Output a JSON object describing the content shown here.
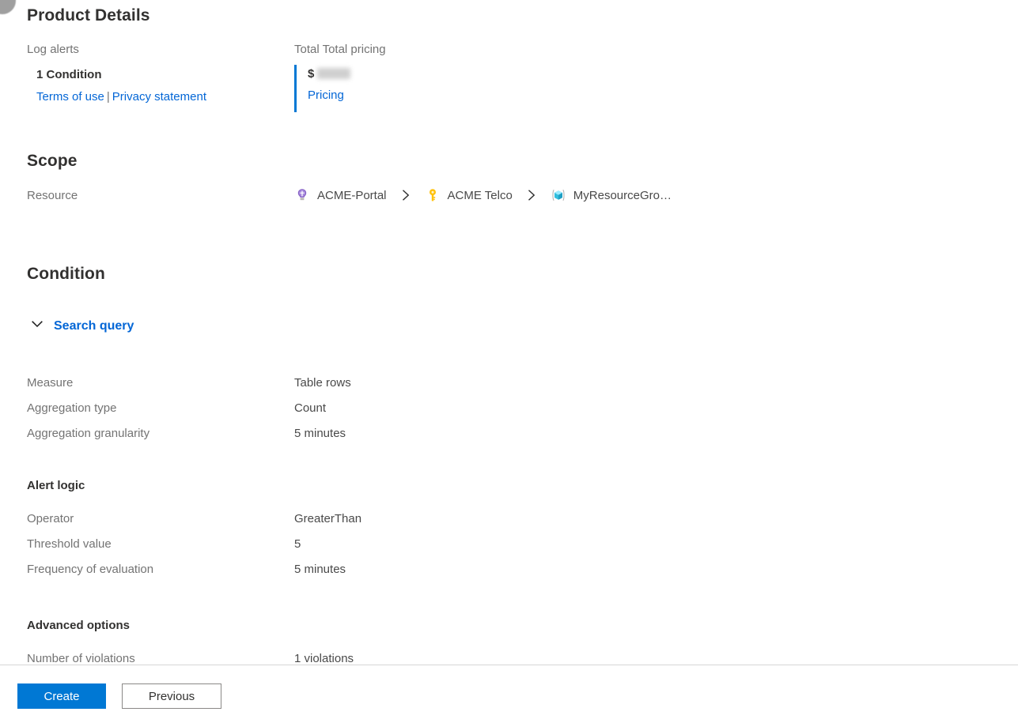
{
  "product_details": {
    "title": "Product Details",
    "log_alerts_label": "Log alerts",
    "condition_count": "1 Condition",
    "terms_of_use": "Terms of use",
    "separator": "|",
    "privacy_statement": "Privacy statement",
    "pricing_label": "Total Total pricing",
    "currency_symbol": "$",
    "price_value": "",
    "pricing_link": "Pricing"
  },
  "scope": {
    "title": "Scope",
    "resource_label": "Resource",
    "breadcrumb": [
      {
        "label": "ACME-Portal",
        "icon": "lightbulb-icon"
      },
      {
        "label": "ACME Telco",
        "icon": "key-icon"
      },
      {
        "label": "MyResourceGro…",
        "icon": "resource-group-icon"
      }
    ]
  },
  "condition": {
    "title": "Condition",
    "search_query_label": "Search query",
    "search_query_expanded": true,
    "measure": [
      {
        "label": "Measure",
        "value": "Table rows"
      },
      {
        "label": "Aggregation type",
        "value": "Count"
      },
      {
        "label": "Aggregation granularity",
        "value": "5 minutes"
      }
    ],
    "alert_logic_title": "Alert logic",
    "alert_logic": [
      {
        "label": "Operator",
        "value": "GreaterThan"
      },
      {
        "label": "Threshold value",
        "value": "5"
      },
      {
        "label": "Frequency of evaluation",
        "value": "5 minutes"
      }
    ],
    "advanced_title": "Advanced options",
    "advanced": [
      {
        "label": "Number of violations",
        "value": "1 violations"
      }
    ]
  },
  "footer": {
    "create_label": "Create",
    "previous_label": "Previous"
  },
  "colors": {
    "accent": "#0078d4",
    "link": "#0366d6",
    "label": "#737373",
    "value": "#494949",
    "heading": "#323130",
    "divider": "#d6d6d6",
    "lightbulb": "#8661c5",
    "key": "#ffc20e",
    "resource_group": "#50e6ff"
  }
}
